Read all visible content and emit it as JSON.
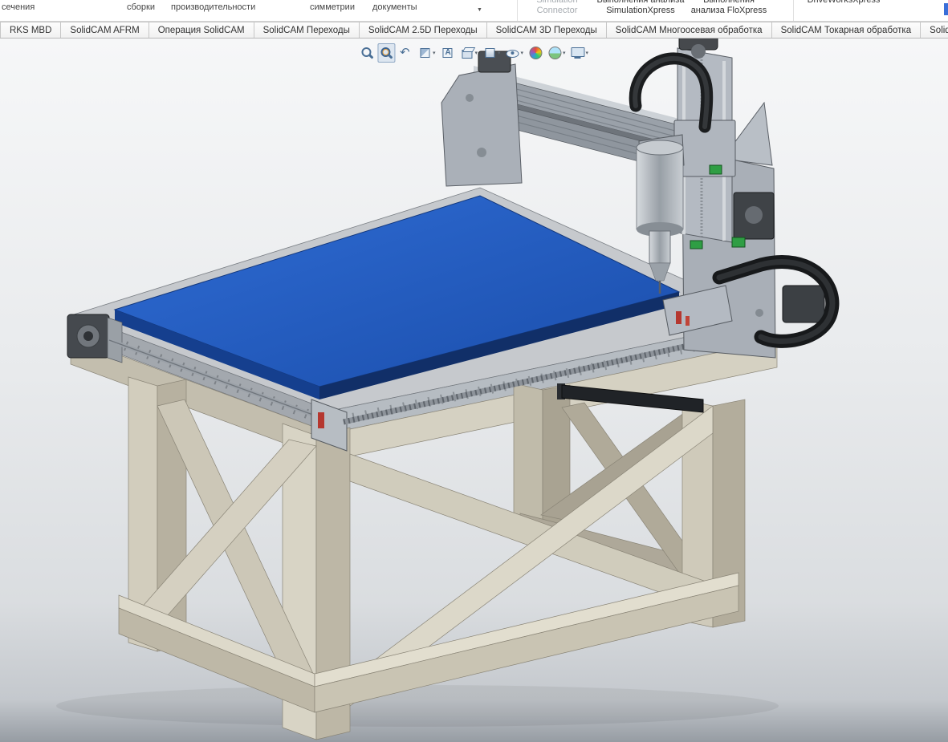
{
  "ribbon": {
    "group_labels": [
      {
        "label": "сечения"
      },
      {
        "label": "сборки"
      },
      {
        "label": "производительности"
      },
      {
        "label": "симметрии"
      },
      {
        "label": "документы",
        "has_dropdown": true
      }
    ],
    "right_items": [
      {
        "line1": "Simulation",
        "line2": "Connector",
        "disabled": true
      },
      {
        "line1": "Выполнения анализа",
        "line2": "SimulationXpress",
        "disabled": false
      },
      {
        "line1": "Выполнения",
        "line2": "анализа FloXpress",
        "disabled": false
      },
      {
        "line1": "",
        "line2": "DriveWorksXpress",
        "disabled": false
      }
    ]
  },
  "tabs": [
    {
      "label": "RKS MBD"
    },
    {
      "label": "SolidCAM AFRM"
    },
    {
      "label": "Операция SolidCAM"
    },
    {
      "label": "SolidCAM Переходы"
    },
    {
      "label": "SolidCAM 2.5D Переходы"
    },
    {
      "label": "SolidCAM 3D Переходы"
    },
    {
      "label": "SolidCAM Многоосевая обработка"
    },
    {
      "label": "SolidCAM Токарная обработка"
    },
    {
      "label": "SolidCAM Ш"
    }
  ],
  "view_toolbar": {
    "buttons": [
      {
        "name": "zoom-to-fit",
        "icon": "magnifier",
        "active": false,
        "has_dropdown": false
      },
      {
        "name": "zoom-to-area",
        "icon": "magnifier-area",
        "active": true,
        "has_dropdown": false
      },
      {
        "name": "previous-view",
        "icon": "undo-arrow",
        "active": false,
        "has_dropdown": false
      },
      {
        "name": "section-view",
        "icon": "section-cube",
        "active": false,
        "has_dropdown": true
      },
      {
        "name": "dynamic-annotation-views",
        "icon": "annotation-cube",
        "active": false,
        "has_dropdown": false
      },
      {
        "name": "view-orientation",
        "icon": "orientation-cube",
        "active": false,
        "has_dropdown": true
      },
      {
        "name": "display-style",
        "icon": "display-cube",
        "active": false,
        "has_dropdown": true
      },
      {
        "name": "hide-show-items",
        "icon": "eye",
        "active": false,
        "has_dropdown": true
      },
      {
        "name": "edit-appearance",
        "icon": "color-ball",
        "active": false,
        "has_dropdown": false
      },
      {
        "name": "apply-scene",
        "icon": "scene-sphere",
        "active": false,
        "has_dropdown": true
      },
      {
        "name": "view-settings",
        "icon": "monitor",
        "active": false,
        "has_dropdown": true
      }
    ]
  },
  "viewport": {
    "model_name": "CNC router machine 3D model",
    "colors": {
      "table_top_blue": "#1d57c0",
      "frame_tan": "#cfcaba",
      "machine_gray": "#aab0b8",
      "cable_chain_black": "#1c1e20",
      "accent_green": "#2f9e44",
      "accent_red": "#b5372f",
      "background_top": "#f6f7f8",
      "background_bottom": "#969ca3"
    }
  }
}
